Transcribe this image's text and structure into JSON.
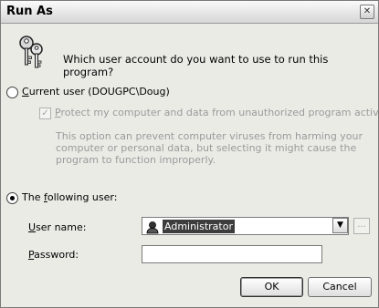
{
  "window": {
    "title": "Run As",
    "close_glyph": "✕"
  },
  "header": {
    "icon": "keys-icon",
    "question": "Which user account do you want to use to run this program?"
  },
  "current_user": {
    "label_accel": "C",
    "label_rest": "urrent user (DOUGPC\\Doug)",
    "selected": false
  },
  "protect": {
    "label_accel": "P",
    "label_rest": "rotect my computer and data from unauthorized program activity",
    "checked": true,
    "enabled": false,
    "check_glyph": "✓",
    "description": "This option can prevent computer viruses from harming your computer or personal data, but selecting it might cause the program to function improperly."
  },
  "following_user": {
    "label_pre": "The ",
    "label_accel": "f",
    "label_rest": "ollowing user:",
    "selected": true
  },
  "fields": {
    "username_label_accel": "U",
    "username_label_rest": "ser name:",
    "username_value": "Administrator",
    "username_icon": "user-icon",
    "dropdown_glyph": "▼",
    "browse_label": "...",
    "password_label_accel": "P",
    "password_label_rest": "assword:",
    "password_value": ""
  },
  "buttons": {
    "ok": "OK",
    "cancel": "Cancel"
  }
}
